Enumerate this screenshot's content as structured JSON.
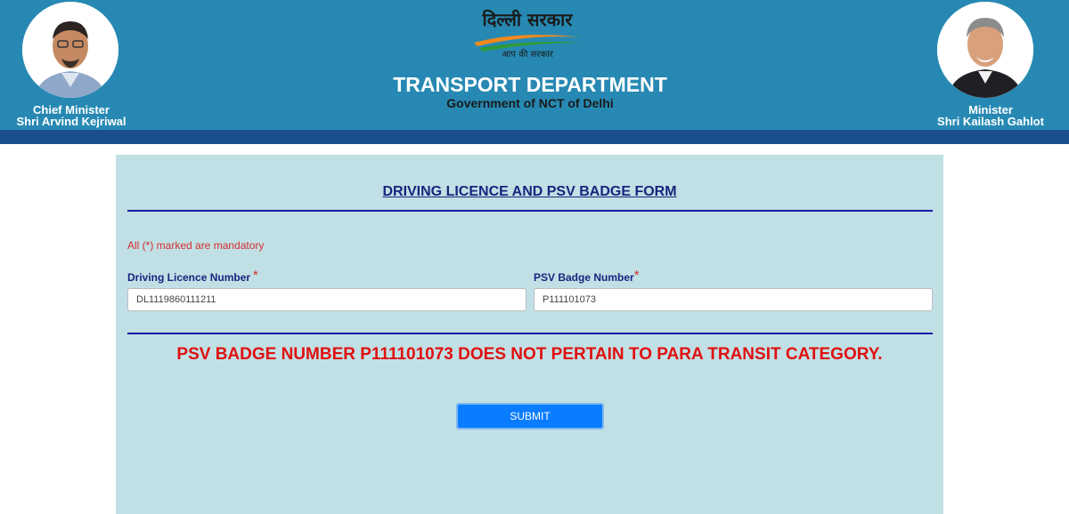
{
  "header": {
    "logo_title": "दिल्ली सरकार",
    "logo_tagline": "आप की सरकार",
    "department_title": "TRANSPORT DEPARTMENT",
    "department_subtitle": "Government of NCT of Delhi",
    "left_official": {
      "role": "Chief Minister",
      "name": "Shri Arvind Kejriwal"
    },
    "right_official": {
      "role": "Minister",
      "name": "Shri Kailash Gahlot"
    }
  },
  "form": {
    "title": "DRIVING LICENCE AND PSV BADGE FORM",
    "mandatory_note": "All (*) marked are mandatory",
    "required_marker": "*",
    "driving_licence": {
      "label": "Driving Licence Number",
      "value": "DL1119860111211"
    },
    "psv_badge": {
      "label": "PSV Badge Number",
      "value": "P111101073"
    },
    "error_message": "PSV BADGE NUMBER P111101073 DOES NOT PERTAIN TO PARA TRANSIT CATEGORY.",
    "submit_label": "SUBMIT"
  },
  "colors": {
    "header_bg": "#2789b3",
    "header_stripe": "#1b4e8e",
    "panel_bg": "#c1e0e5",
    "heading_blue": "#1a237e",
    "error_red": "#e01010",
    "button_blue": "#0a7cff"
  }
}
